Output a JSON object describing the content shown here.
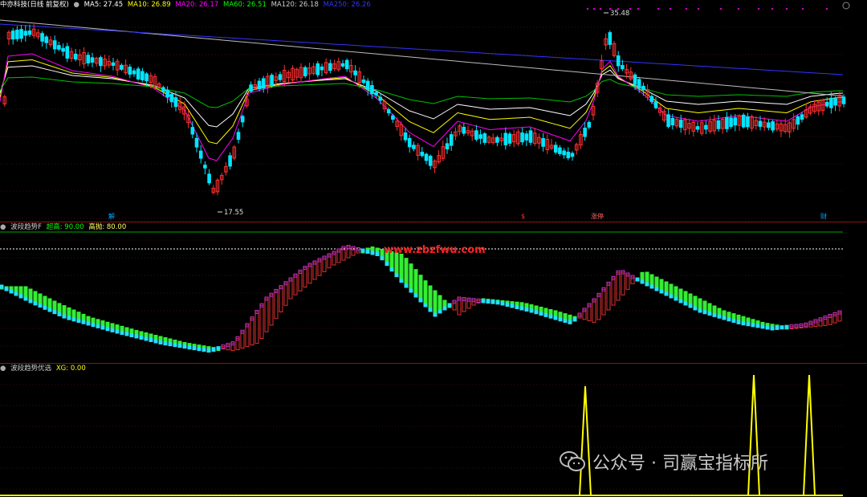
{
  "main_panel": {
    "title": "中亦科技(日线 前复权)",
    "ma_items": [
      {
        "label": "MA5: 27.45",
        "color": "#ffffff"
      },
      {
        "label": "MA10: 26.89",
        "color": "#ffff00"
      },
      {
        "label": "MA20: 26.17",
        "color": "#ff00ff"
      },
      {
        "label": "MA60: 26.51",
        "color": "#00ff00"
      },
      {
        "label": "MA120: 26.18",
        "color": "#cccccc"
      },
      {
        "label": "MA250: 26.26",
        "color": "#3333ff"
      }
    ],
    "high_label": "35.48",
    "low_label": "17.55",
    "event_marks": [
      {
        "label": "解",
        "color": "#00aaff"
      },
      {
        "label": "$",
        "color": "#ff3333"
      },
      {
        "label": "涨停",
        "color": "#ff6666"
      },
      {
        "label": "财",
        "color": "#00aaff"
      }
    ]
  },
  "indicator_panel": {
    "title": "波段趋势F",
    "items": [
      {
        "label": "超高: 90.00",
        "color": "#00ff00"
      },
      {
        "label": "高抛: 80.00",
        "color": "#ffff66"
      }
    ],
    "site_watermark": "www.zbzfwu.com"
  },
  "signal_panel": {
    "title": "波段趋势优选",
    "items": [
      {
        "label": "XG: 0.00",
        "color": "#ffff00"
      }
    ]
  },
  "watermark": {
    "text": "公众号 · 司赢宝指标所"
  },
  "colors": {
    "up": "#ff3030",
    "down": "#00e5ff",
    "separator": "#8b1414",
    "signal": "#ffff00"
  }
}
